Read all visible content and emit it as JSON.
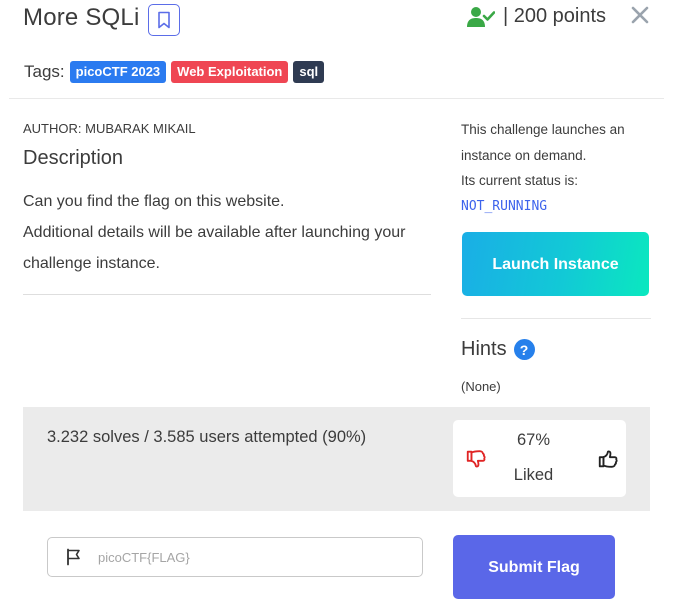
{
  "challenge": {
    "title": "More SQLi",
    "points": "| 200 points",
    "tags_label": "Tags:",
    "tags": [
      {
        "label": "picoCTF 2023",
        "color": "#2b7bf0"
      },
      {
        "label": "Web Exploitation",
        "color": "#ef4653"
      },
      {
        "label": "sql",
        "color": "#2f3b52"
      }
    ],
    "author": "AUTHOR: MUBARAK MIKAIL",
    "description_title": "Description",
    "description_line1": "Can you find the flag on this website.",
    "description_line2": "Additional details will be available after launching your challenge instance."
  },
  "instance": {
    "info_line1": "This challenge launches an instance on demand.",
    "info_line2": "Its current status is:",
    "status": "NOT_RUNNING",
    "launch_label": "Launch Instance"
  },
  "hints": {
    "title": "Hints",
    "help_glyph": "?",
    "content": "(None)"
  },
  "stats": {
    "solves_text": "3.232 solves / 3.585 users attempted (90%)",
    "liked_percent": "67%",
    "liked_label": "Liked"
  },
  "submission": {
    "placeholder": "picoCTF{FLAG}",
    "submit_label": "Submit Flag"
  },
  "colors": {
    "accent": "#5a67e8",
    "status_text": "#3d63ec",
    "check_green": "#3aa846",
    "thumb_down": "#e02424"
  },
  "icons": [
    "bookmark-icon",
    "user-check-icon",
    "close-icon",
    "help-icon",
    "thumb-down-icon",
    "thumb-up-icon",
    "flag-icon"
  ]
}
